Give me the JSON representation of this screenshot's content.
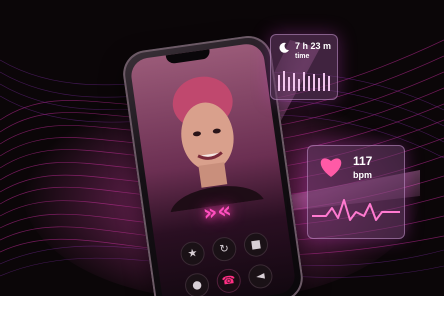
{
  "sleep_card": {
    "value": "7 h 23 m",
    "label": "time",
    "icon": "moon-icon"
  },
  "heart_card": {
    "value": "117",
    "label": "bpm",
    "icon": "heart-icon"
  },
  "phone": {
    "brand_mark": "»«",
    "controls": [
      {
        "name": "favorite",
        "icon": "★"
      },
      {
        "name": "switch-camera",
        "icon": "↻"
      },
      {
        "name": "video",
        "icon": "■"
      },
      {
        "name": "mute",
        "icon": "●"
      },
      {
        "name": "end-call",
        "icon": "☎"
      },
      {
        "name": "speaker",
        "icon": "◄"
      }
    ]
  },
  "colors": {
    "background": "#0b0608",
    "accent_pink": "#ff3fb0",
    "end_call": "#ff2f84",
    "card": "#6e3c6e"
  }
}
